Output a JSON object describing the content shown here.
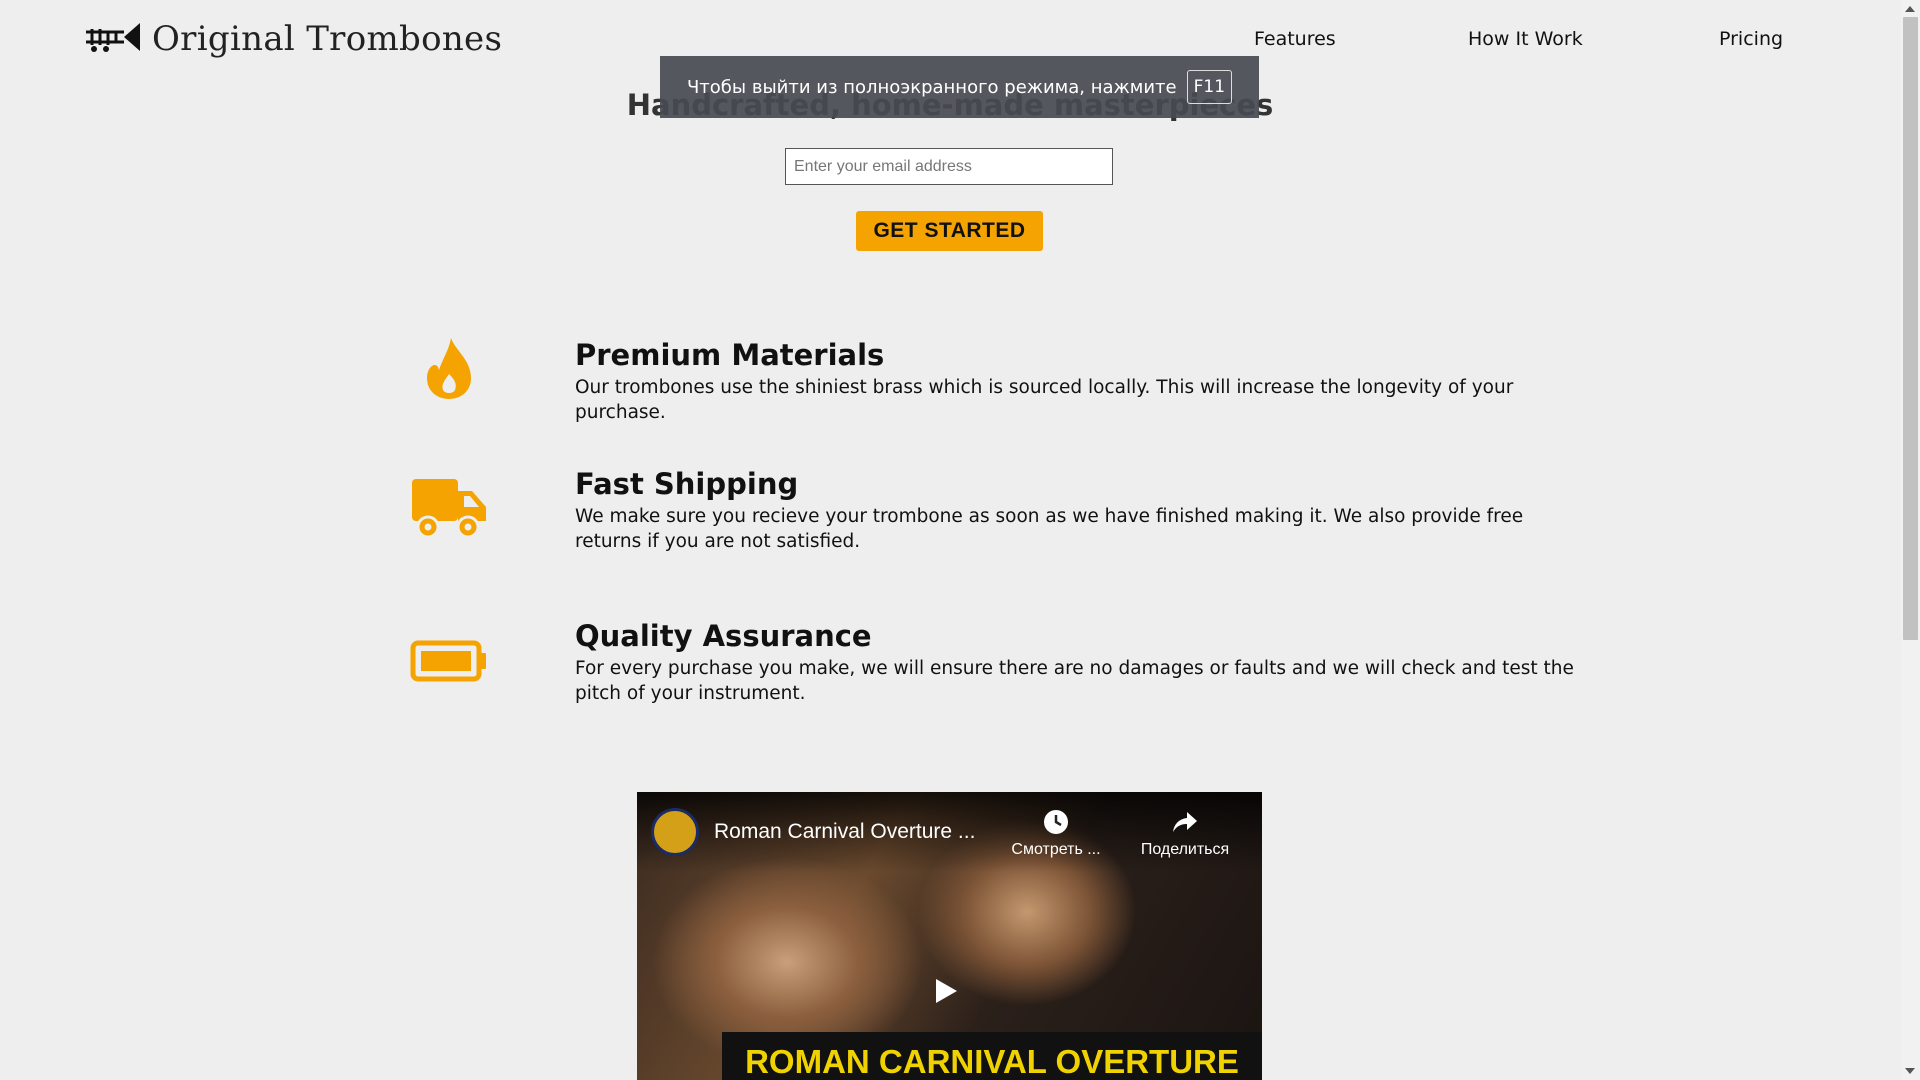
{
  "header": {
    "brand": "Original Trombones",
    "brand_icon": "trombone-icon",
    "nav": [
      {
        "label": "Features"
      },
      {
        "label": "How It Work"
      },
      {
        "label": "Pricing"
      }
    ]
  },
  "hero": {
    "title": "Handcrafted, home-made masterpieces",
    "email_placeholder": "Enter your email address",
    "cta_label": "GET STARTED"
  },
  "fullscreen_notice": {
    "text": "Чтобы выйти из полноэкранного режима, нажмите",
    "key": "F11"
  },
  "features": [
    {
      "icon": "fire-icon",
      "title": "Premium Materials",
      "description": "Our trombones use the shiniest brass which is sourced locally. This will increase the longevity of your purchase."
    },
    {
      "icon": "truck-icon",
      "title": "Fast Shipping",
      "description": "We make sure you recieve your trombone as soon as we have finished making it. We also provide free returns if you are not satisfied."
    },
    {
      "icon": "battery-icon",
      "title": "Quality Assurance",
      "description": "For every purchase you make, we will ensure there are no damages or faults and we will check and test the pitch of your instrument."
    }
  ],
  "video": {
    "title": "Roman Carnival Overture ...",
    "watch_later_label": "Смотреть ...",
    "share_label": "Поделиться",
    "banner_text": "ROMAN CARNIVAL OVERTURE"
  },
  "colors": {
    "accent": "#f5a300",
    "background": "#eeeeee",
    "text": "#111111"
  }
}
